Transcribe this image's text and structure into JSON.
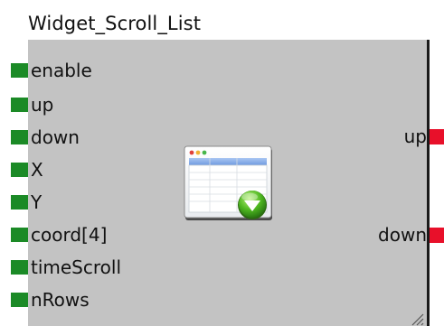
{
  "block": {
    "title": "Widget_Scroll_List",
    "icon": "scroll-list-widget-icon",
    "inputs": [
      {
        "label": "enable"
      },
      {
        "label": "up"
      },
      {
        "label": "down"
      },
      {
        "label": "X"
      },
      {
        "label": "Y"
      },
      {
        "label": "coord[4]"
      },
      {
        "label": "timeScroll"
      },
      {
        "label": "nRows"
      }
    ],
    "outputs": [
      {
        "label": "up"
      },
      {
        "label": "down"
      }
    ]
  },
  "colors": {
    "input_pin": "#1b8a26",
    "output_pin": "#e8102a",
    "block_fill": "#c3c3c3",
    "block_border": "#1a1a1a"
  }
}
